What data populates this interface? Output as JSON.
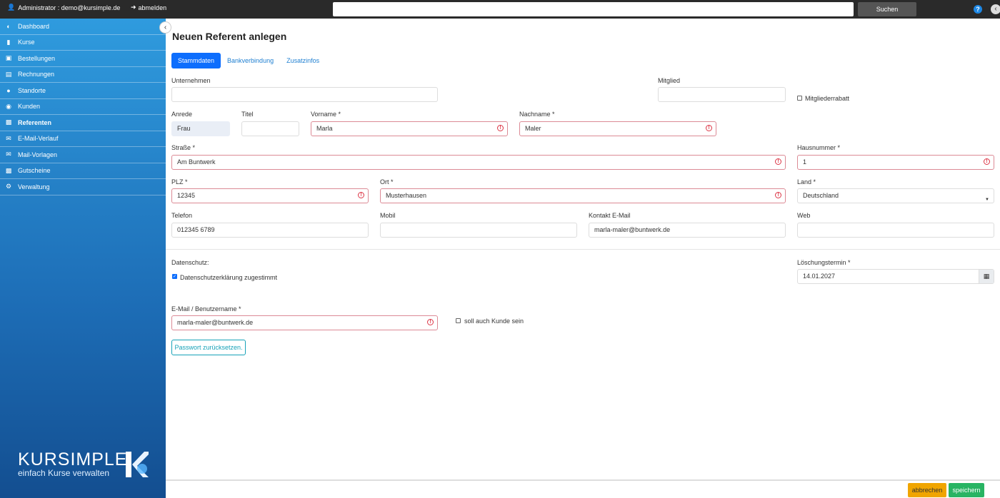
{
  "topbar": {
    "user_label": "Administrator : demo@kursimple.de",
    "logout_label": "abmelden",
    "search_placeholder": "",
    "search_button": "Suchen",
    "help_label": "?"
  },
  "sidebar": {
    "items": [
      {
        "label": "Dashboard",
        "icon": "dashboard-icon"
      },
      {
        "label": "Kurse",
        "icon": "book-icon"
      },
      {
        "label": "Bestellungen",
        "icon": "cart-icon"
      },
      {
        "label": "Rechnungen",
        "icon": "file-icon"
      },
      {
        "label": "Standorte",
        "icon": "map-pin-icon"
      },
      {
        "label": "Kunden",
        "icon": "users-icon"
      },
      {
        "label": "Referenten",
        "icon": "presenter-icon"
      },
      {
        "label": "E-Mail-Verlauf",
        "icon": "envelope-icon"
      },
      {
        "label": "Mail-Vorlagen",
        "icon": "mail-template-icon"
      },
      {
        "label": "Gutscheine",
        "icon": "gift-icon"
      },
      {
        "label": "Verwaltung",
        "icon": "gear-icon"
      }
    ],
    "active_index": 6,
    "logo_brand": "KURSIMPLE",
    "logo_tagline": "einfach Kurse verwalten"
  },
  "main": {
    "title": "Neuen Referent anlegen",
    "tabs": [
      {
        "label": "Stammdaten",
        "active": true
      },
      {
        "label": "Bankverbindung",
        "active": false
      },
      {
        "label": "Zusatzinfos",
        "active": false
      }
    ],
    "form": {
      "unternehmen_label": "Unternehmen",
      "unternehmen_value": "",
      "mitglied_label": "Mitglied",
      "mitglied_value": "",
      "mitgliederrabatt_label": "Mitgliederrabatt",
      "anrede_label": "Anrede",
      "anrede_value": "Frau",
      "titel_label": "Titel",
      "titel_value": "",
      "vorname_label": "Vorname *",
      "vorname_value": "Marla",
      "nachname_label": "Nachname *",
      "nachname_value": "Maler",
      "strasse_label": "Straße *",
      "strasse_value": "Am Buntwerk",
      "hausnummer_label": "Hausnummer *",
      "hausnummer_value": "1",
      "plz_label": "PLZ *",
      "plz_value": "12345",
      "ort_label": "Ort *",
      "ort_value": "Musterhausen",
      "land_label": "Land *",
      "land_value": "Deutschland",
      "telefon_label": "Telefon",
      "telefon_value": "012345 6789",
      "mobil_label": "Mobil",
      "mobil_value": "",
      "kontakt_email_label": "Kontakt E-Mail",
      "kontakt_email_value": "marla-maler@buntwerk.de",
      "web_label": "Web",
      "web_value": "",
      "datenschutz_label": "Datenschutz:",
      "datenschutz_checkbox_label": "Datenschutzerklärung zugestimmt",
      "loeschung_label": "Löschungstermin *",
      "loeschung_value": "14.01.2027",
      "login_label": "E-Mail / Benutzername *",
      "login_value": "marla-maler@buntwerk.de",
      "kunde_checkbox_label": "soll auch Kunde sein",
      "password_reset_button": "Passwort zurücksetzen."
    }
  },
  "footer": {
    "cancel_button": "abbrechen",
    "save_button": "speichern"
  }
}
